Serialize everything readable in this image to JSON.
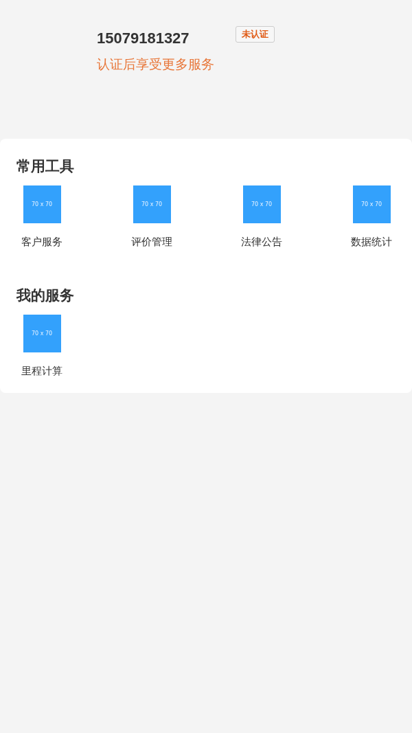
{
  "profile": {
    "phone": "15079181327",
    "badge": "未认证",
    "hint": "认证后享受更多服务"
  },
  "sections": [
    {
      "title": "常用工具",
      "items": [
        {
          "label": "客户服务",
          "image_text": "70 x 70"
        },
        {
          "label": "评价管理",
          "image_text": "70 x 70"
        },
        {
          "label": "法律公告",
          "image_text": "70 x 70"
        },
        {
          "label": "数据统计",
          "image_text": "70 x 70"
        }
      ]
    },
    {
      "title": "我的服务",
      "items": [
        {
          "label": "里程计算",
          "image_text": "70 x 70"
        }
      ]
    }
  ]
}
